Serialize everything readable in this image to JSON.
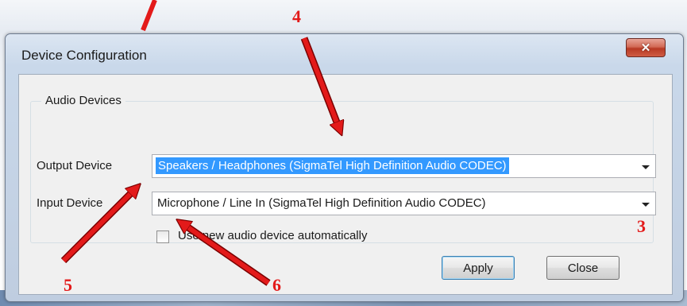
{
  "window": {
    "title": "Device Configuration",
    "close_glyph": "✕"
  },
  "audio_devices": {
    "group_title": "Audio Devices",
    "output": {
      "label": "Output Device",
      "value": "Speakers / Headphones (SigmaTel High Definition Audio CODEC)"
    },
    "input": {
      "label": "Input Device",
      "value": "Microphone / Line In (SigmaTel High Definition Audio CODEC)"
    },
    "auto_checkbox": {
      "label": "Use new audio device automatically",
      "checked": false
    }
  },
  "buttons": {
    "apply": "Apply",
    "close": "Close"
  },
  "annotations": {
    "n3": "3",
    "n4": "4",
    "n5": "5",
    "n6": "6",
    "color": "#e31a1a"
  }
}
